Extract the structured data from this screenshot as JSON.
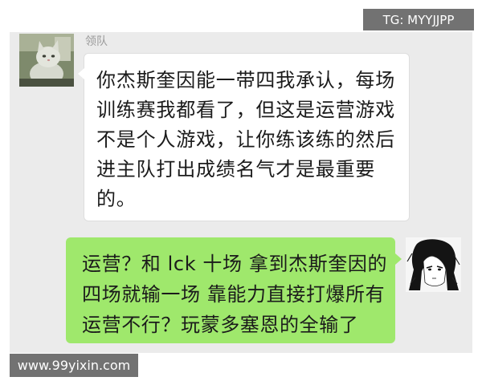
{
  "colors": {
    "chat_background": "#ebebeb",
    "incoming_bubble": "#ffffff",
    "outgoing_bubble": "#9fe86c",
    "message_text": "#1b1b1b",
    "sender_name": "#9a9a9a",
    "watermark_background": "#5f5f5f",
    "watermark_text": "#ffffff"
  },
  "watermarks": {
    "top_right": "TG: MYYJJPP",
    "bottom_left": "www.99yixin.com"
  },
  "conversation": {
    "messages": [
      {
        "sender_name": "领队",
        "avatar_icon": "cat-avatar-icon",
        "lines": [
          "你杰斯奎因能一带四我承认，每场",
          "训练赛我都看了，但这是运营游戏",
          "不是个人游戏，让你练该练的然后",
          "进主队打出成绩名气才是最重要",
          "的。"
        ]
      },
      {
        "avatar_icon": "anime-character-avatar-icon",
        "lines": [
          "运营？和 lck 十场 拿到杰斯奎因的",
          "四场就输一场 靠能力直接打爆所有",
          "运营不行？玩蒙多塞恩的全输了"
        ]
      }
    ]
  }
}
